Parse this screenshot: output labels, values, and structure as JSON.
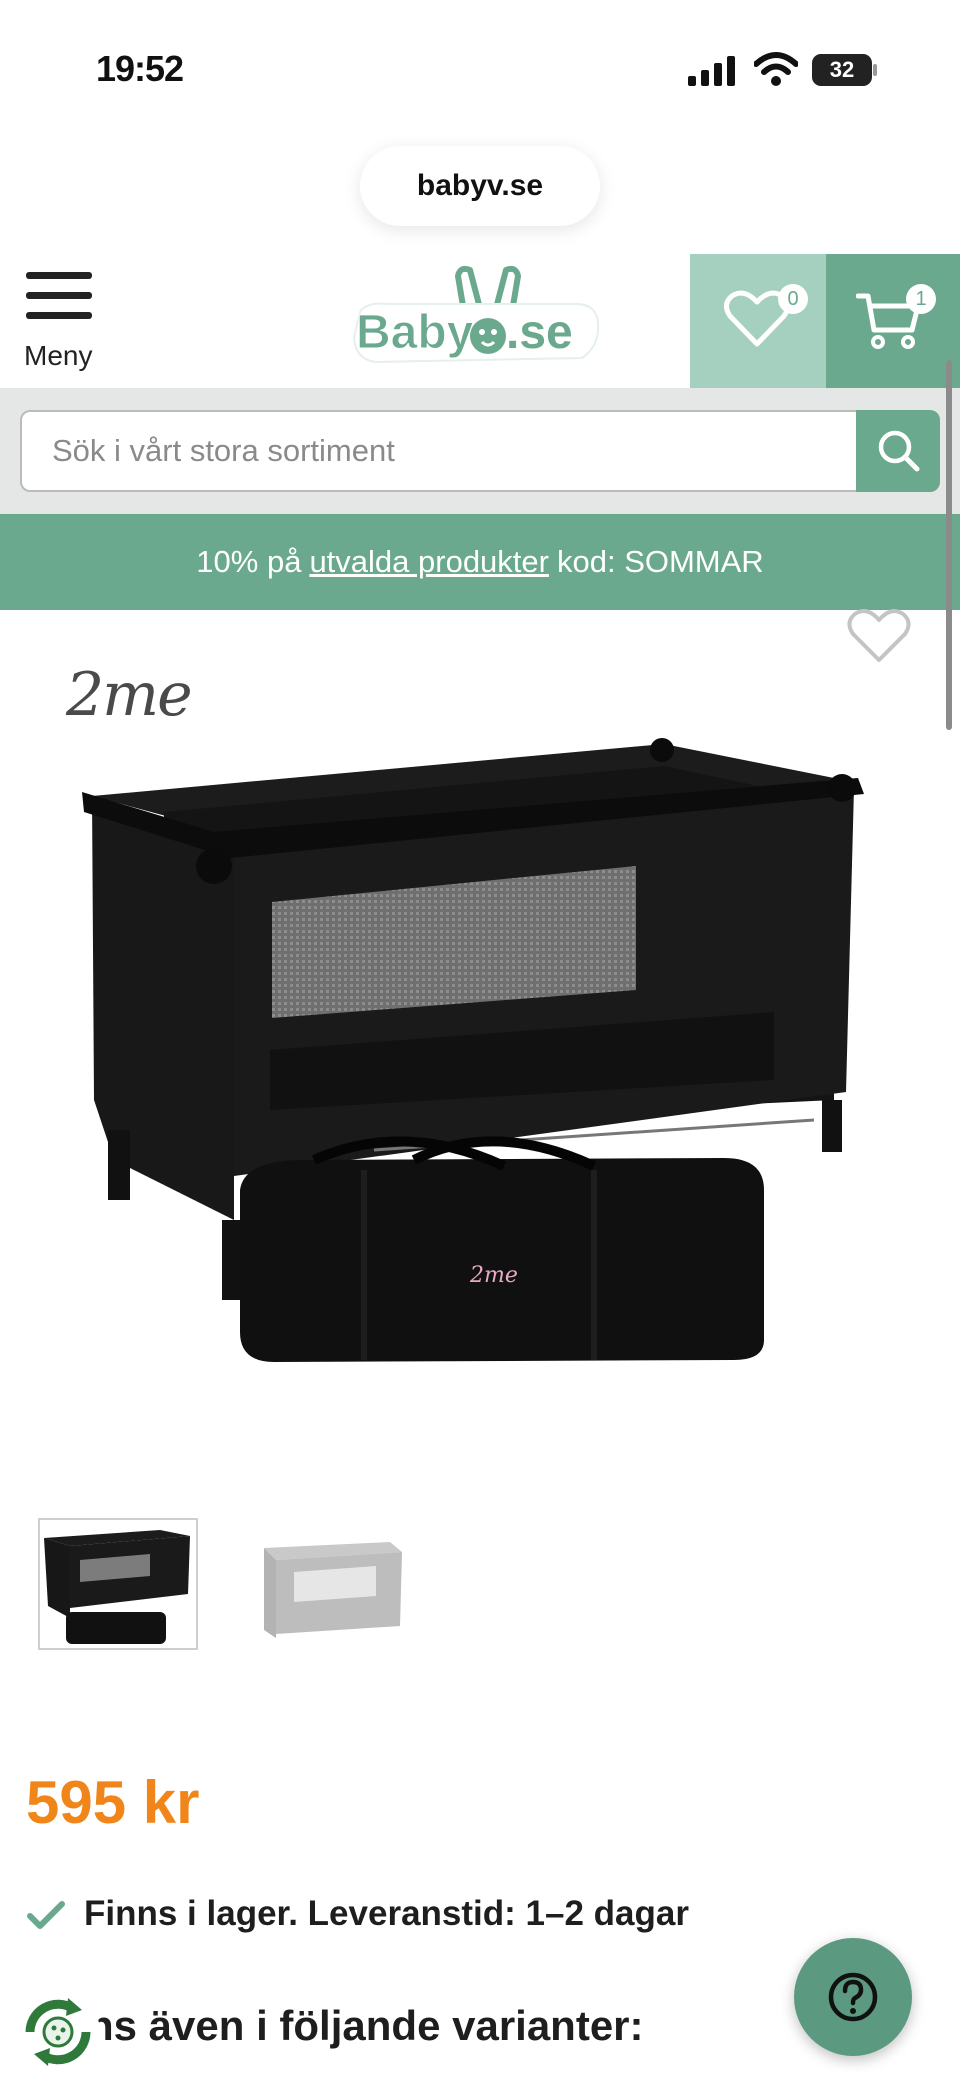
{
  "status_bar": {
    "time": "19:52",
    "battery": "32"
  },
  "browser": {
    "url": "babyv.se"
  },
  "header": {
    "menu_label": "Meny",
    "logo_text": "BabyV.se",
    "wishlist_count": "0",
    "cart_count": "1"
  },
  "search": {
    "placeholder": "Sök i vårt stora sortiment"
  },
  "promo": {
    "prefix": "10% på",
    "link": "utvalda produkter",
    "suffix": "kod: SOMMAR"
  },
  "product": {
    "brand": "2me",
    "price": "595 kr",
    "stock": "Finns i lager. Leveranstid: 1–2 dagar",
    "variants_heading": "ns även i följande varianter:"
  },
  "colors": {
    "accent": "#6aa98d",
    "accent_light": "#a5cfbf",
    "price": "#f0861a",
    "search_bg": "#e5e7e6"
  }
}
